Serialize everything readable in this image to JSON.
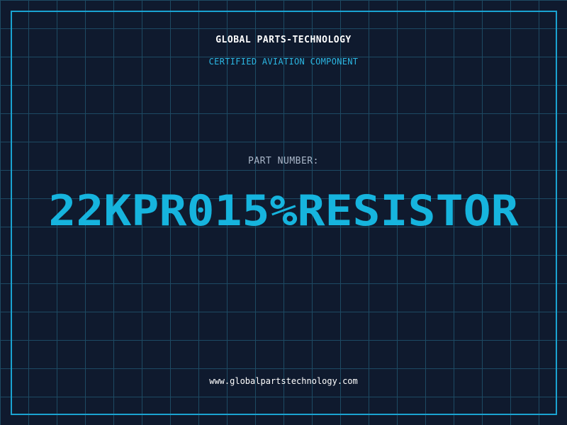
{
  "header": {
    "brand": "GLOBAL PARTS-TECHNOLOGY",
    "subtitle": "CERTIFIED AVIATION COMPONENT"
  },
  "part": {
    "label": "PART NUMBER:",
    "number": "22KPR015%RESISTOR"
  },
  "footer": {
    "url": "www.globalpartstechnology.com"
  },
  "colors": {
    "background": "#0f1a2e",
    "grid": "#1d4a63",
    "accent": "#16b4de",
    "frame": "#1aa3d1"
  }
}
